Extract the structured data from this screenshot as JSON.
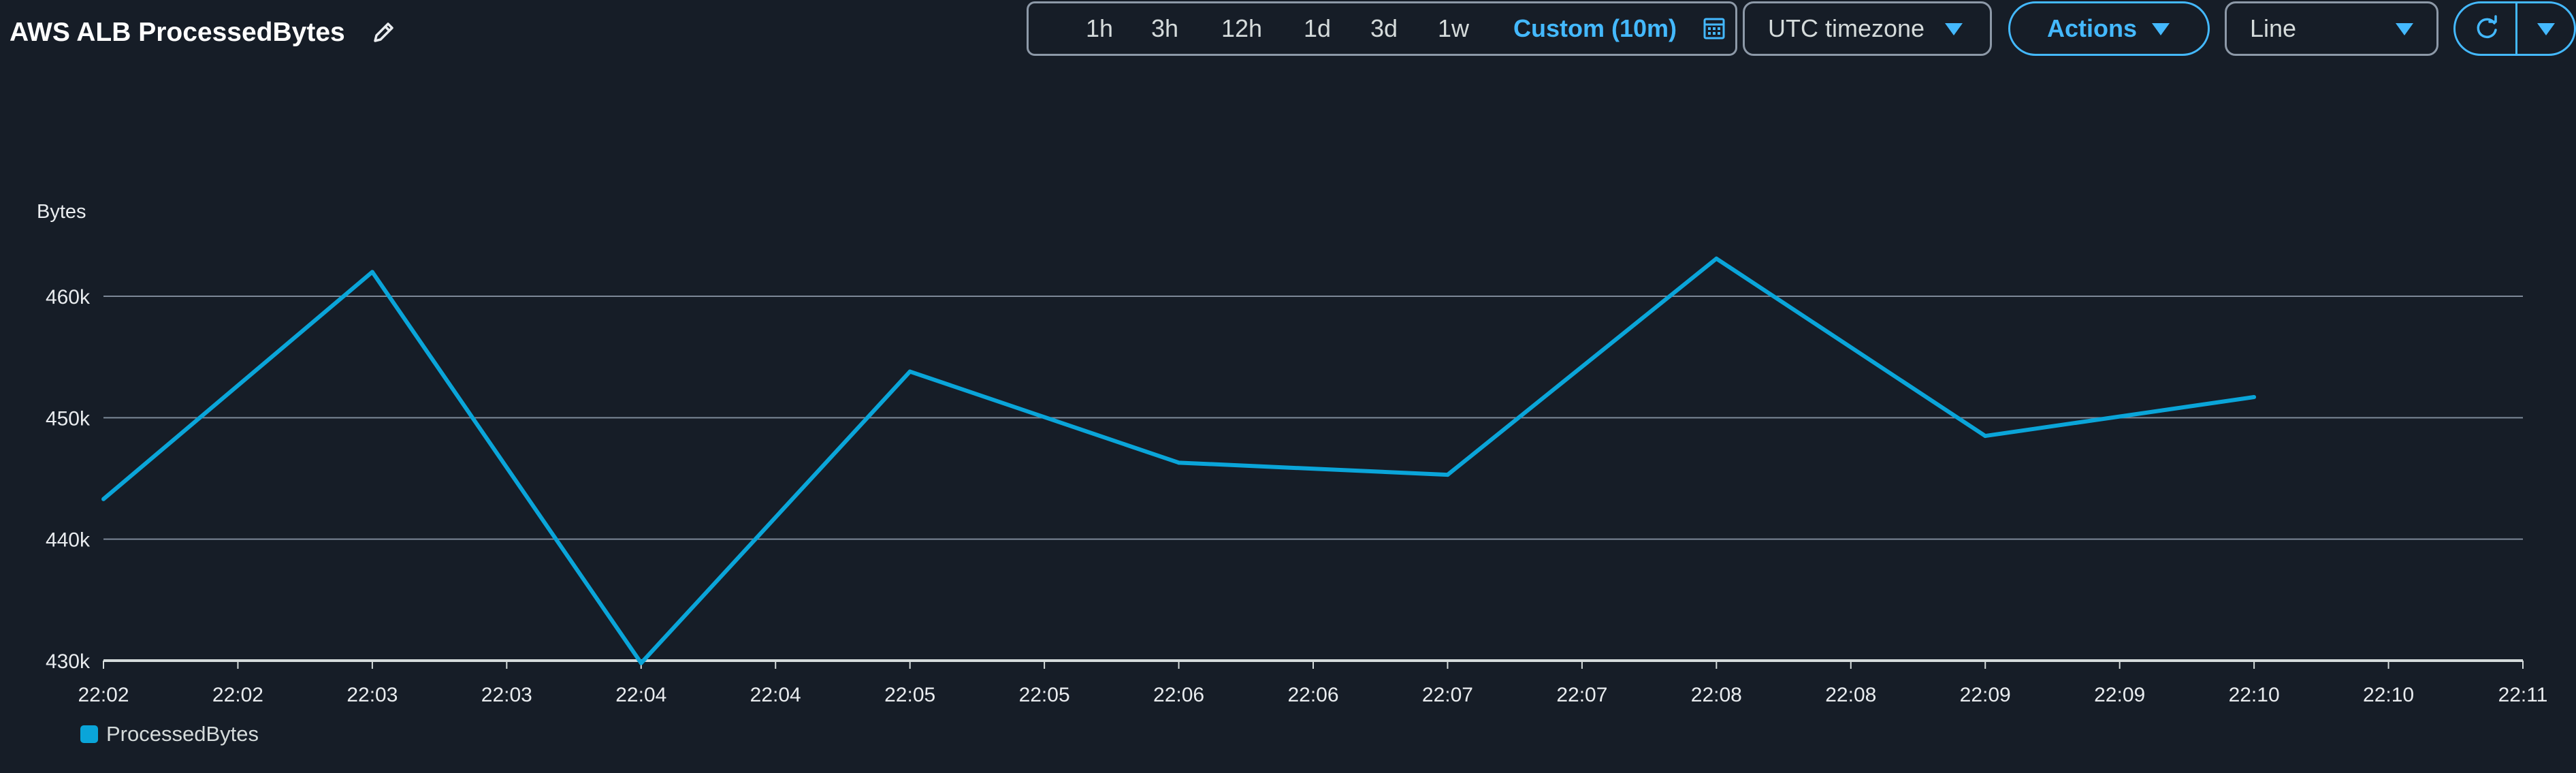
{
  "header": {
    "title": "AWS ALB ProcessedBytes",
    "edit_icon": "pencil-icon"
  },
  "toolbar": {
    "ranges": [
      "1h",
      "3h",
      "12h",
      "1d",
      "3d",
      "1w"
    ],
    "custom_label": "Custom (10m)",
    "calendar_icon": "calendar-icon",
    "timezone_label": "UTC timezone",
    "actions_label": "Actions",
    "chart_type_label": "Line",
    "refresh_icon": "refresh-icon",
    "accent_color": "#44b9ff"
  },
  "legend": {
    "label": "ProcessedBytes",
    "color": "#0aa5d9"
  },
  "chart_data": {
    "type": "line",
    "ylabel": "Bytes",
    "y_ticks": [
      "430k",
      "440k",
      "450k",
      "460k"
    ],
    "y_tick_values": [
      430000,
      440000,
      450000,
      460000
    ],
    "ylim": [
      430000,
      460000
    ],
    "x_ticks": [
      "22:02",
      "22:02",
      "22:03",
      "22:03",
      "22:04",
      "22:04",
      "22:05",
      "22:05",
      "22:06",
      "22:06",
      "22:07",
      "22:07",
      "22:08",
      "22:08",
      "22:09",
      "22:09",
      "22:10",
      "22:10",
      "22:11"
    ],
    "grid": true,
    "series": [
      {
        "name": "ProcessedBytes",
        "color": "#0aa5d9",
        "x": [
          "22:02",
          "22:03",
          "22:04",
          "22:05",
          "22:06",
          "22:07",
          "22:08",
          "22:09",
          "22:10"
        ],
        "values": [
          443300,
          462000,
          429800,
          453800,
          446300,
          445300,
          463100,
          448500,
          451700
        ]
      }
    ]
  }
}
